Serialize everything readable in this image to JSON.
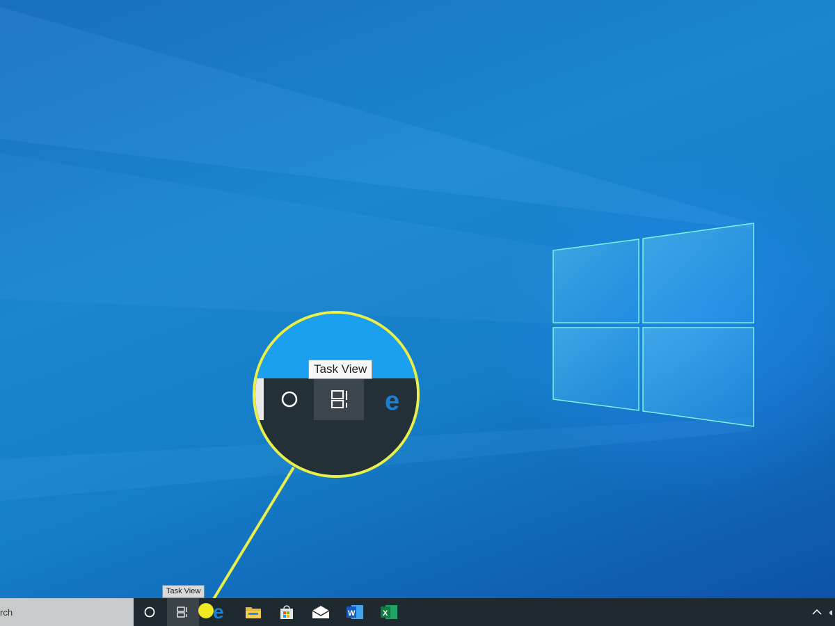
{
  "wallpaper": {
    "accent": "#1a86cf",
    "logo_glow": "#6ff0e0"
  },
  "callout": {
    "color": "#e9f04a",
    "tooltip_label": "Task View"
  },
  "taskbar": {
    "background": "#1f2a30",
    "search": {
      "visible_text": "rch"
    },
    "tooltip": "Task View",
    "buttons": [
      {
        "name": "cortana",
        "icon": "circle-icon"
      },
      {
        "name": "task-view",
        "icon": "task-view-icon",
        "active": true
      },
      {
        "name": "edge",
        "icon": "edge-icon"
      },
      {
        "name": "file-explorer",
        "icon": "folder-icon"
      },
      {
        "name": "store",
        "icon": "store-bag-icon"
      },
      {
        "name": "mail",
        "icon": "mail-icon"
      },
      {
        "name": "word",
        "icon": "word-icon",
        "letter": "W"
      },
      {
        "name": "excel",
        "icon": "excel-icon",
        "letter": "X"
      }
    ],
    "tray": {
      "overflow_icon": "chevron-up-icon",
      "cloud_icon": "onedrive-cloud-icon"
    }
  }
}
